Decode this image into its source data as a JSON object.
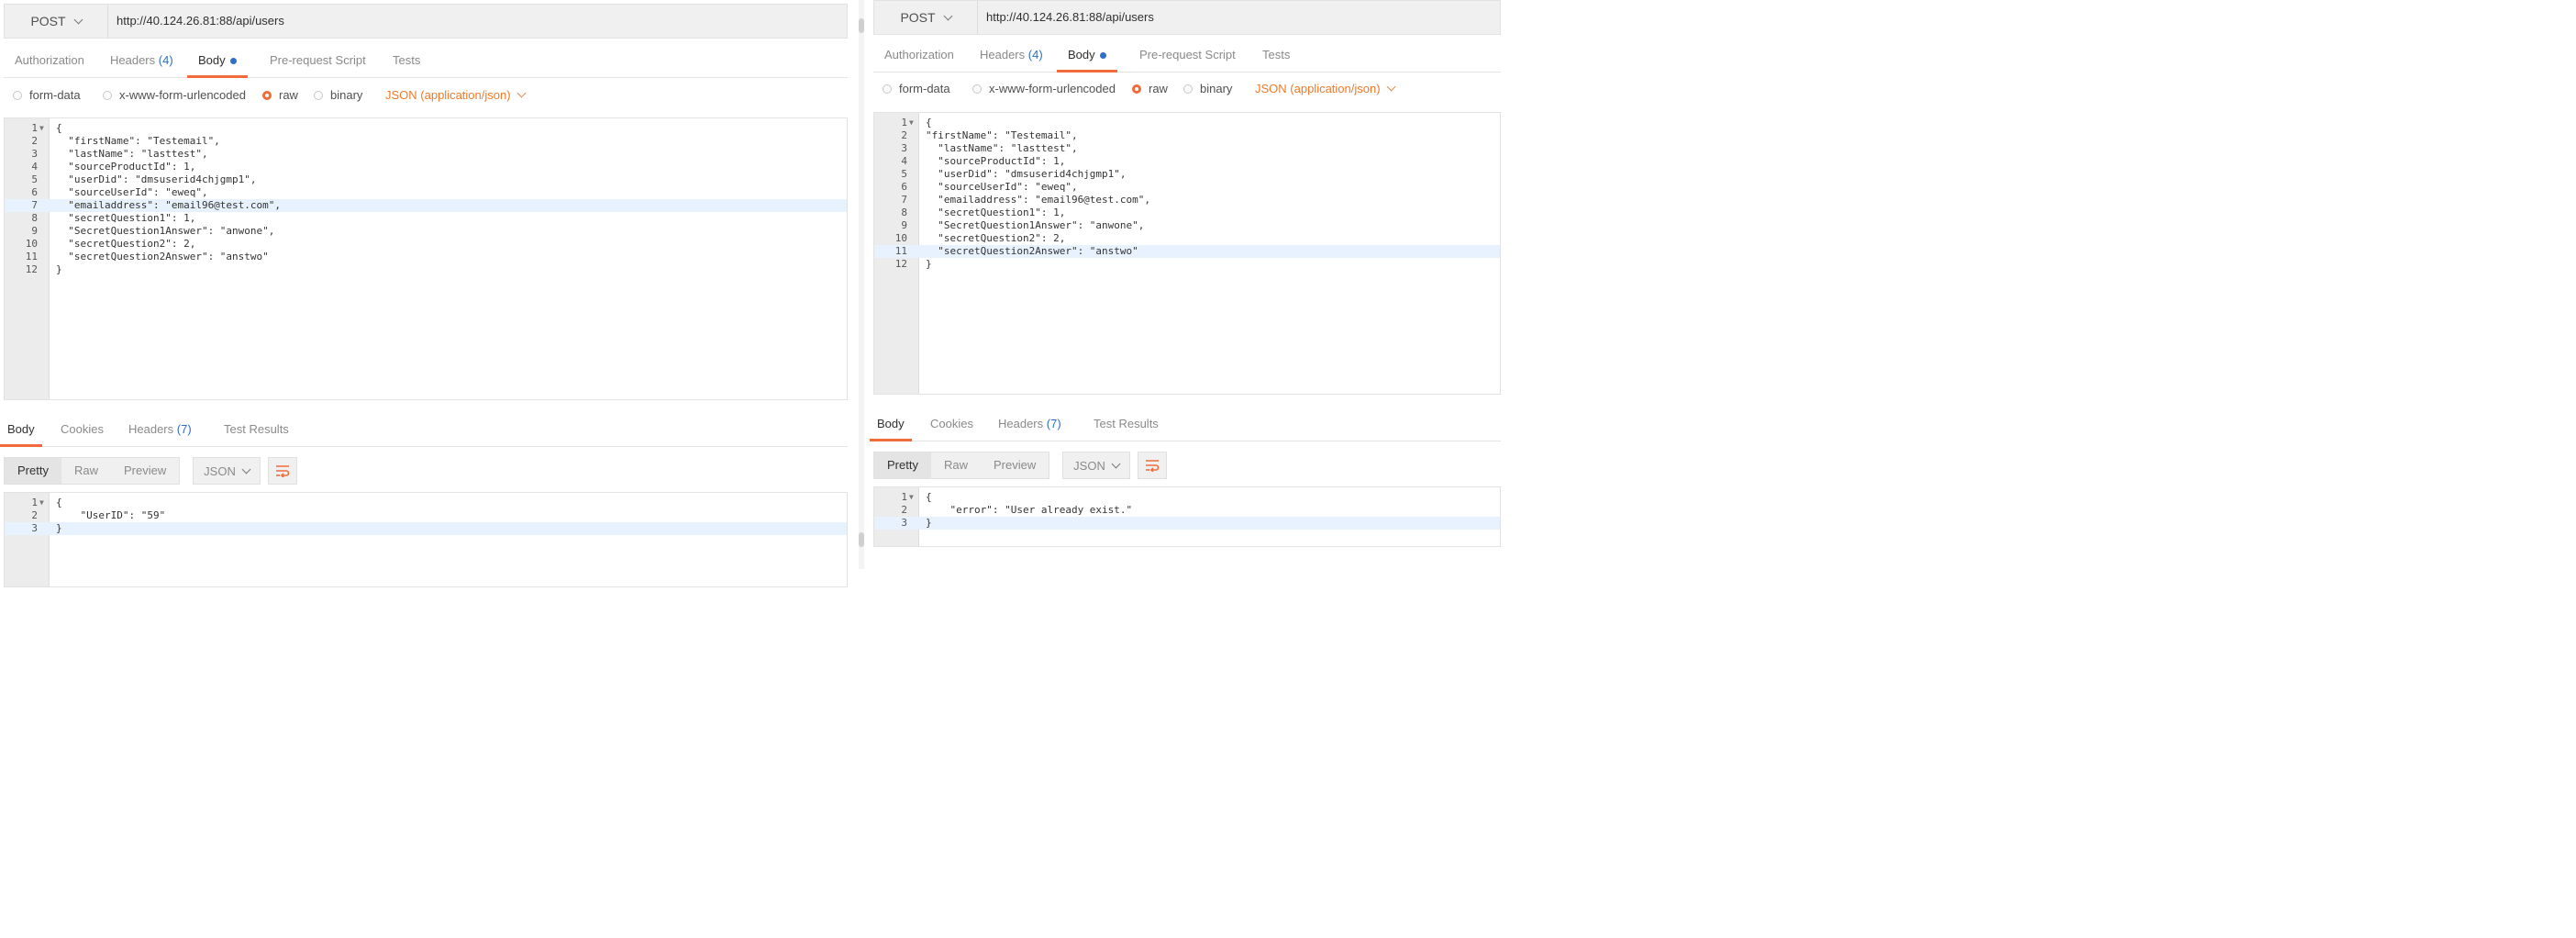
{
  "panes": {
    "left": {
      "method": "POST",
      "url": "http://40.124.26.81:88/api/users",
      "request_tabs": [
        {
          "label": "Authorization",
          "count": ""
        },
        {
          "label": "Headers",
          "count": "(4)"
        },
        {
          "label": "Body",
          "count": ""
        },
        {
          "label": "Pre-request Script",
          "count": ""
        },
        {
          "label": "Tests",
          "count": ""
        }
      ],
      "body_types": [
        "form-data",
        "x-www-form-urlencoded",
        "raw",
        "binary"
      ],
      "content_type": "JSON (application/json)",
      "request_lines": [
        {
          "n": "1",
          "t": "{"
        },
        {
          "n": "2",
          "t": "  \"firstName\": \"Testemail\","
        },
        {
          "n": "3",
          "t": "  \"lastName\": \"lasttest\","
        },
        {
          "n": "4",
          "t": "  \"sourceProductId\": 1,"
        },
        {
          "n": "5",
          "t": "  \"userDid\": \"dmsuserid4chjgmp1\","
        },
        {
          "n": "6",
          "t": "  \"sourceUserId\": \"eweq\","
        },
        {
          "n": "7",
          "t": "  \"emailaddress\": \"email96@test.com\","
        },
        {
          "n": "8",
          "t": "  \"secretQuestion1\": 1,"
        },
        {
          "n": "9",
          "t": "  \"SecretQuestion1Answer\": \"anwone\","
        },
        {
          "n": "10",
          "t": "  \"secretQuestion2\": 2,"
        },
        {
          "n": "11",
          "t": "  \"secretQuestion2Answer\": \"anstwo\""
        },
        {
          "n": "12",
          "t": "}"
        }
      ],
      "response_tabs": [
        {
          "label": "Body",
          "count": ""
        },
        {
          "label": "Cookies",
          "count": ""
        },
        {
          "label": "Headers",
          "count": "(7)"
        },
        {
          "label": "Test Results",
          "count": ""
        }
      ],
      "view_modes": [
        "Pretty",
        "Raw",
        "Preview"
      ],
      "format": "JSON",
      "response_lines": [
        {
          "n": "1",
          "t": "{"
        },
        {
          "n": "2",
          "t": "    \"UserID\": \"59\""
        },
        {
          "n": "3",
          "t": "}"
        }
      ]
    },
    "right": {
      "method": "POST",
      "url": "http://40.124.26.81:88/api/users",
      "request_tabs": [
        {
          "label": "Authorization",
          "count": ""
        },
        {
          "label": "Headers",
          "count": "(4)"
        },
        {
          "label": "Body",
          "count": ""
        },
        {
          "label": "Pre-request Script",
          "count": ""
        },
        {
          "label": "Tests",
          "count": ""
        }
      ],
      "body_types": [
        "form-data",
        "x-www-form-urlencoded",
        "raw",
        "binary"
      ],
      "content_type": "JSON (application/json)",
      "request_lines": [
        {
          "n": "1",
          "t": "{"
        },
        {
          "n": "2",
          "t": "\"firstName\": \"Testemail\","
        },
        {
          "n": "3",
          "t": "  \"lastName\": \"lasttest\","
        },
        {
          "n": "4",
          "t": "  \"sourceProductId\": 1,"
        },
        {
          "n": "5",
          "t": "  \"userDid\": \"dmsuserid4chjgmp1\","
        },
        {
          "n": "6",
          "t": "  \"sourceUserId\": \"eweq\","
        },
        {
          "n": "7",
          "t": "  \"emailaddress\": \"email96@test.com\","
        },
        {
          "n": "8",
          "t": "  \"secretQuestion1\": 1,"
        },
        {
          "n": "9",
          "t": "  \"SecretQuestion1Answer\": \"anwone\","
        },
        {
          "n": "10",
          "t": "  \"secretQuestion2\": 2,"
        },
        {
          "n": "11",
          "t": "  \"secretQuestion2Answer\": \"anstwo\""
        },
        {
          "n": "12",
          "t": "}"
        }
      ],
      "response_tabs": [
        {
          "label": "Body",
          "count": ""
        },
        {
          "label": "Cookies",
          "count": ""
        },
        {
          "label": "Headers",
          "count": "(7)"
        },
        {
          "label": "Test Results",
          "count": ""
        }
      ],
      "view_modes": [
        "Pretty",
        "Raw",
        "Preview"
      ],
      "format": "JSON",
      "response_lines": [
        {
          "n": "1",
          "t": "{"
        },
        {
          "n": "2",
          "t": "    \"error\": \"User already exist.\""
        },
        {
          "n": "3",
          "t": "}"
        }
      ]
    }
  },
  "colors": {
    "accent": "#f26b3a",
    "link_count": "#2f6fc6",
    "content_type": "#f07a2a",
    "highlight_line": "#e8f2ff"
  }
}
